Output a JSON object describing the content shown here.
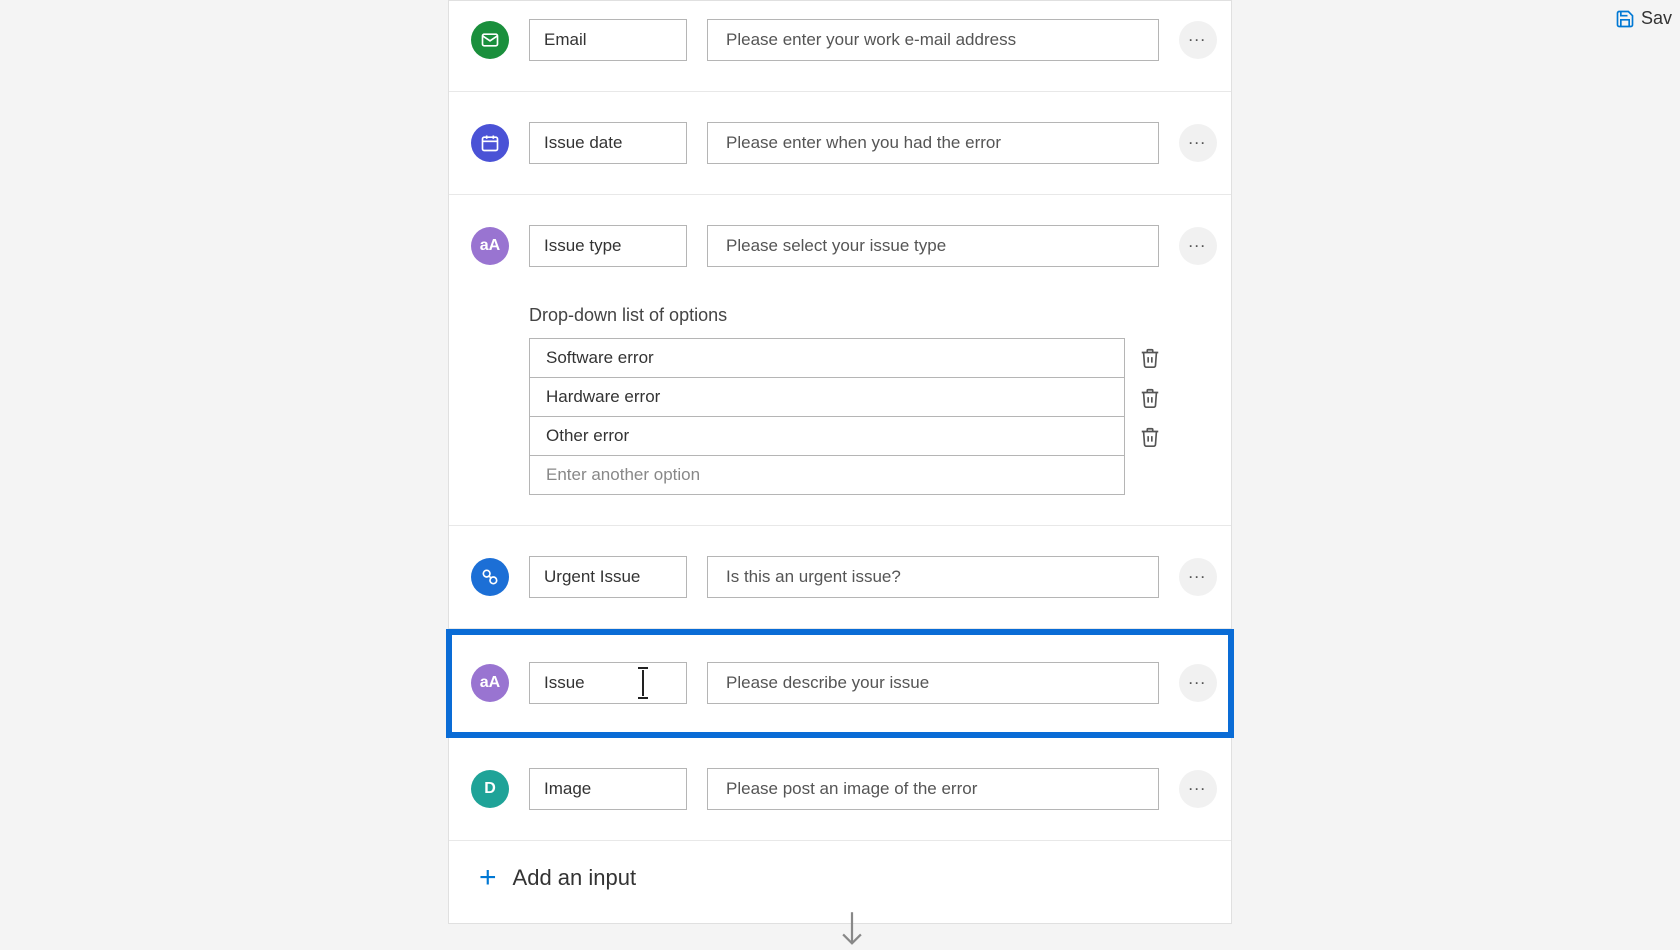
{
  "toolbar": {
    "save_label": "Sav"
  },
  "rows": {
    "email": {
      "label": "Email",
      "placeholder": "Please enter your work e-mail address"
    },
    "date": {
      "label": "Issue date",
      "placeholder": "Please enter when you had the error"
    },
    "type": {
      "label": "Issue type",
      "placeholder": "Please select your issue type",
      "options_title": "Drop-down list of options",
      "options": {
        "0": "Software error",
        "1": "Hardware error",
        "2": "Other error"
      },
      "add_option_placeholder": "Enter another option"
    },
    "urgent": {
      "label": "Urgent Issue",
      "placeholder": "Is this an urgent issue?"
    },
    "issue": {
      "label": "Issue",
      "placeholder": "Please describe your issue"
    },
    "image": {
      "label": "Image",
      "placeholder": "Please post an image of the error"
    }
  },
  "badges": {
    "text": "aA",
    "file": "D"
  },
  "actions": {
    "add_input": "Add an input"
  }
}
